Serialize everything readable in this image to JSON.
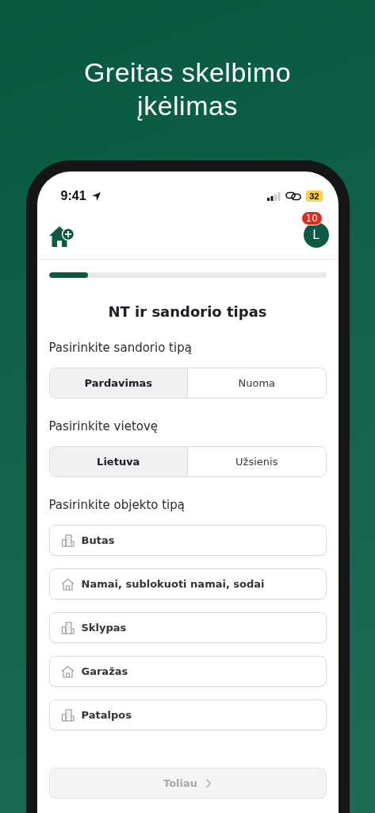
{
  "headline": "Greitas skelbimo įkėlimas",
  "status_bar": {
    "time": "9:41",
    "battery": "32"
  },
  "header": {
    "avatar": "L",
    "badge": "10"
  },
  "progress": {
    "level": 0.14
  },
  "title": "NT ir sandorio tipas",
  "sections": [
    {
      "label": "Pasirinkite sandorio tipą",
      "options": [
        {
          "label": "Pardavimas",
          "selected": true
        },
        {
          "label": "Nuoma",
          "selected": false
        }
      ]
    },
    {
      "label": "Pasirinkite vietovę",
      "options": [
        {
          "label": "Lietuva",
          "selected": true
        },
        {
          "label": "Užsienis",
          "selected": false
        }
      ]
    }
  ],
  "object_section": {
    "label": "Pasirinkite objekto tipą",
    "items": [
      {
        "label": "Butas",
        "kind": "building"
      },
      {
        "label": "Namai, sublokuoti namai, sodai",
        "kind": "house"
      },
      {
        "label": "Sklypas",
        "kind": "building"
      },
      {
        "label": "Garažas",
        "kind": "house"
      },
      {
        "label": "Patalpos",
        "kind": "building"
      }
    ]
  },
  "next_button": {
    "label": "Toliau",
    "disabled": true
  }
}
